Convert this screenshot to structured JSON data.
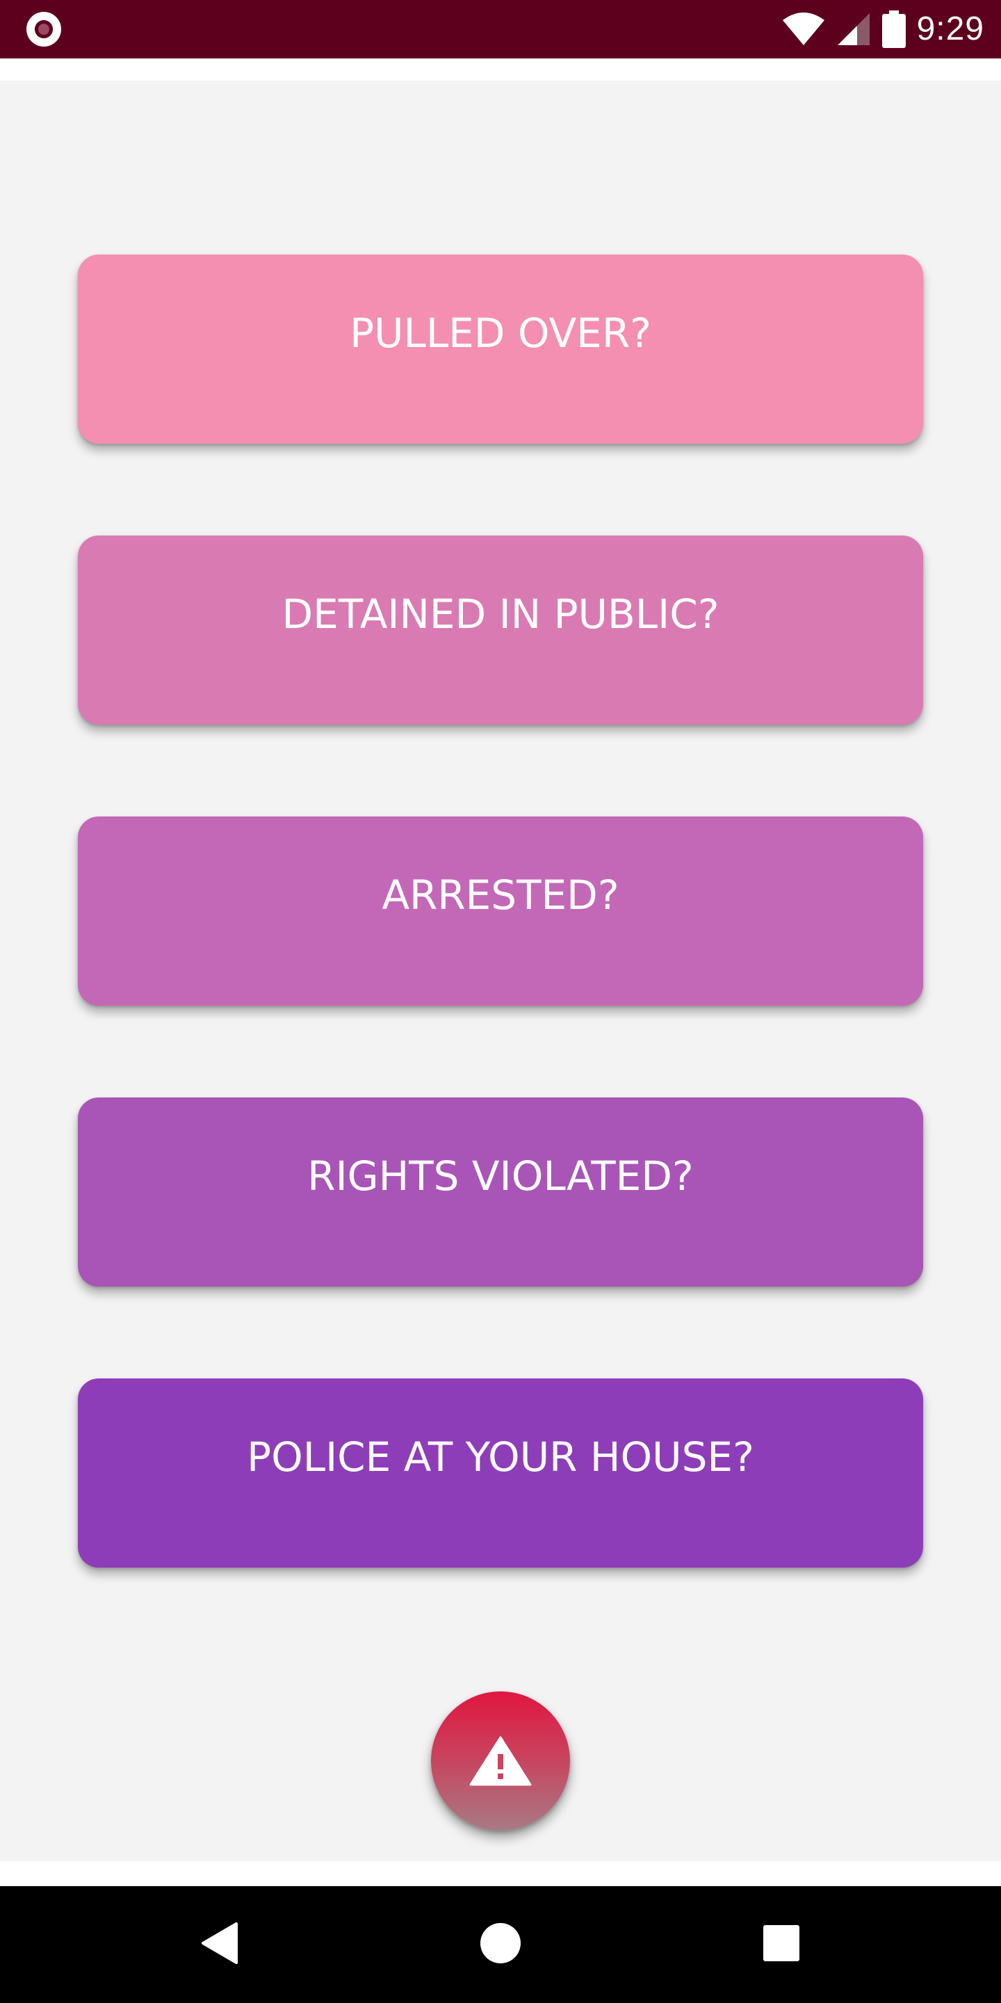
{
  "status_bar": {
    "time": "9:29",
    "left_icon": "app-notification-icon",
    "icons": [
      "wifi-icon",
      "signal-icon",
      "battery-icon"
    ],
    "background_color": "#5c001e"
  },
  "options": [
    {
      "label": "PULLED OVER?",
      "color": "#f48fb1"
    },
    {
      "label": "DETAINED IN PUBLIC?",
      "color": "#da7ab2"
    },
    {
      "label": "ARRESTED?",
      "color": "#c368b6"
    },
    {
      "label": "RIGHTS VIOLATED?",
      "color": "#a955b8"
    },
    {
      "label": "POLICE AT YOUR HOUSE?",
      "color": "#8e3db8"
    }
  ],
  "fab": {
    "icon": "warning-icon",
    "color_top": "#e0163f",
    "color_bottom": "#a87a85"
  },
  "nav_bar": {
    "buttons": [
      "back-icon",
      "home-icon",
      "recents-icon"
    ]
  },
  "colors": {
    "content_background": "#f3f3f3",
    "label_text": "#ffffff"
  }
}
